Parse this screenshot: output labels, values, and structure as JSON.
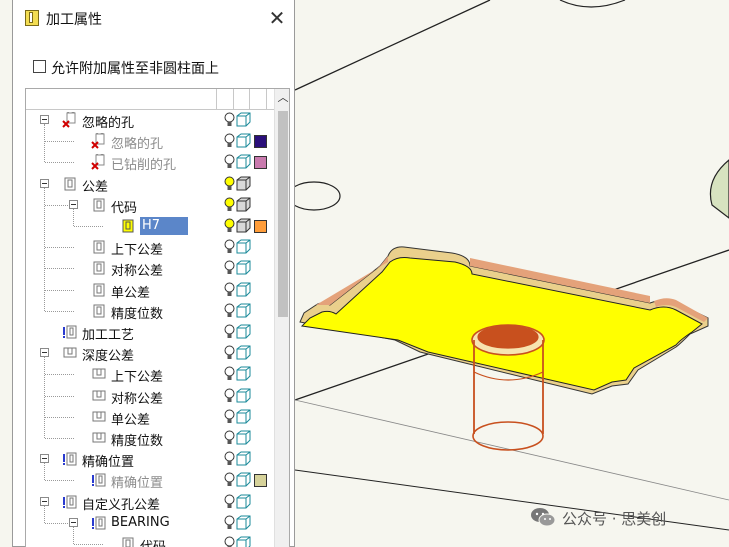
{
  "dialog": {
    "title": "加工属性",
    "close_label": "✕",
    "allow_checkbox_label": "允许附加属性至非圆柱面上",
    "allow_checked": false
  },
  "tree": {
    "rows": [
      {
        "label": "忽略的孔",
        "depth": 0,
        "toggle": true,
        "icon": "hole-ignored-icon",
        "style": "normal",
        "bulb": "off",
        "cube": "outline",
        "swatch": null
      },
      {
        "label": "忽略的孔",
        "depth": 1,
        "toggle": false,
        "icon": "hole-ignored-icon",
        "style": "dim",
        "bulb": "off",
        "cube": "outline",
        "swatch": "#2a0f7a"
      },
      {
        "label": "已钻削的孔",
        "depth": 1,
        "toggle": false,
        "icon": "hole-ignored-icon",
        "style": "dim",
        "bulb": "off",
        "cube": "outline",
        "swatch": "#c97aae"
      },
      {
        "label": "公差",
        "depth": 0,
        "toggle": true,
        "icon": "tolerance-icon",
        "style": "normal",
        "bulb": "on",
        "cube": "solid",
        "swatch": null
      },
      {
        "label": "代码",
        "depth": 1,
        "toggle": true,
        "icon": "tolerance-icon",
        "style": "normal",
        "bulb": "on",
        "cube": "solid",
        "swatch": null
      },
      {
        "label": "H7",
        "depth": 2,
        "toggle": false,
        "icon": "tolerance-yellow-icon",
        "style": "selected",
        "bulb": "on",
        "cube": "solid",
        "swatch": "#ff9d3a"
      },
      {
        "label": "上下公差",
        "depth": 1,
        "toggle": false,
        "icon": "tolerance-icon",
        "style": "normal",
        "bulb": "off",
        "cube": "outline",
        "swatch": null
      },
      {
        "label": "对称公差",
        "depth": 1,
        "toggle": false,
        "icon": "tolerance-icon",
        "style": "normal",
        "bulb": "off",
        "cube": "outline",
        "swatch": null
      },
      {
        "label": "单公差",
        "depth": 1,
        "toggle": false,
        "icon": "tolerance-icon",
        "style": "normal",
        "bulb": "off",
        "cube": "outline",
        "swatch": null
      },
      {
        "label": "精度位数",
        "depth": 1,
        "toggle": false,
        "icon": "tolerance-icon",
        "style": "normal",
        "bulb": "off",
        "cube": "outline",
        "swatch": null
      },
      {
        "label": "加工工艺",
        "depth": 0,
        "toggle": false,
        "icon": "process-icon",
        "style": "normal",
        "bulb": "off",
        "cube": "outline",
        "swatch": null
      },
      {
        "label": "深度公差",
        "depth": 0,
        "toggle": true,
        "icon": "depth-icon",
        "style": "normal",
        "bulb": "off",
        "cube": "outline",
        "swatch": null
      },
      {
        "label": "上下公差",
        "depth": 1,
        "toggle": false,
        "icon": "depth-icon",
        "style": "normal",
        "bulb": "off",
        "cube": "outline",
        "swatch": null
      },
      {
        "label": "对称公差",
        "depth": 1,
        "toggle": false,
        "icon": "depth-icon",
        "style": "normal",
        "bulb": "off",
        "cube": "outline",
        "swatch": null
      },
      {
        "label": "单公差",
        "depth": 1,
        "toggle": false,
        "icon": "depth-icon",
        "style": "normal",
        "bulb": "off",
        "cube": "outline",
        "swatch": null
      },
      {
        "label": "精度位数",
        "depth": 1,
        "toggle": false,
        "icon": "depth-icon",
        "style": "normal",
        "bulb": "off",
        "cube": "outline",
        "swatch": null
      },
      {
        "label": "精确位置",
        "depth": 0,
        "toggle": true,
        "icon": "process-icon",
        "style": "normal",
        "bulb": "off",
        "cube": "outline",
        "swatch": null
      },
      {
        "label": "精确位置",
        "depth": 1,
        "toggle": false,
        "icon": "process-icon",
        "style": "dim",
        "bulb": "off",
        "cube": "outline",
        "swatch": "#d6d29a"
      },
      {
        "label": "自定义孔公差",
        "depth": 0,
        "toggle": true,
        "icon": "process-icon",
        "style": "normal",
        "bulb": "off",
        "cube": "outline",
        "swatch": null
      },
      {
        "label": "BEARING",
        "depth": 1,
        "toggle": true,
        "icon": "process-icon",
        "style": "normal",
        "bulb": "off",
        "cube": "outline",
        "swatch": null
      },
      {
        "label": "代码",
        "depth": 2,
        "toggle": false,
        "icon": "tolerance-icon",
        "style": "normal",
        "bulb": "off",
        "cube": "outline",
        "swatch": null
      }
    ]
  },
  "watermark": {
    "text": "公众号 · 思美创",
    "icon": "wechat-icon"
  },
  "viewport": {
    "face_color": "#ffff00",
    "wall_color": "#e4a27a",
    "edge_color": "#333333",
    "hole_color": "#c8501e"
  }
}
